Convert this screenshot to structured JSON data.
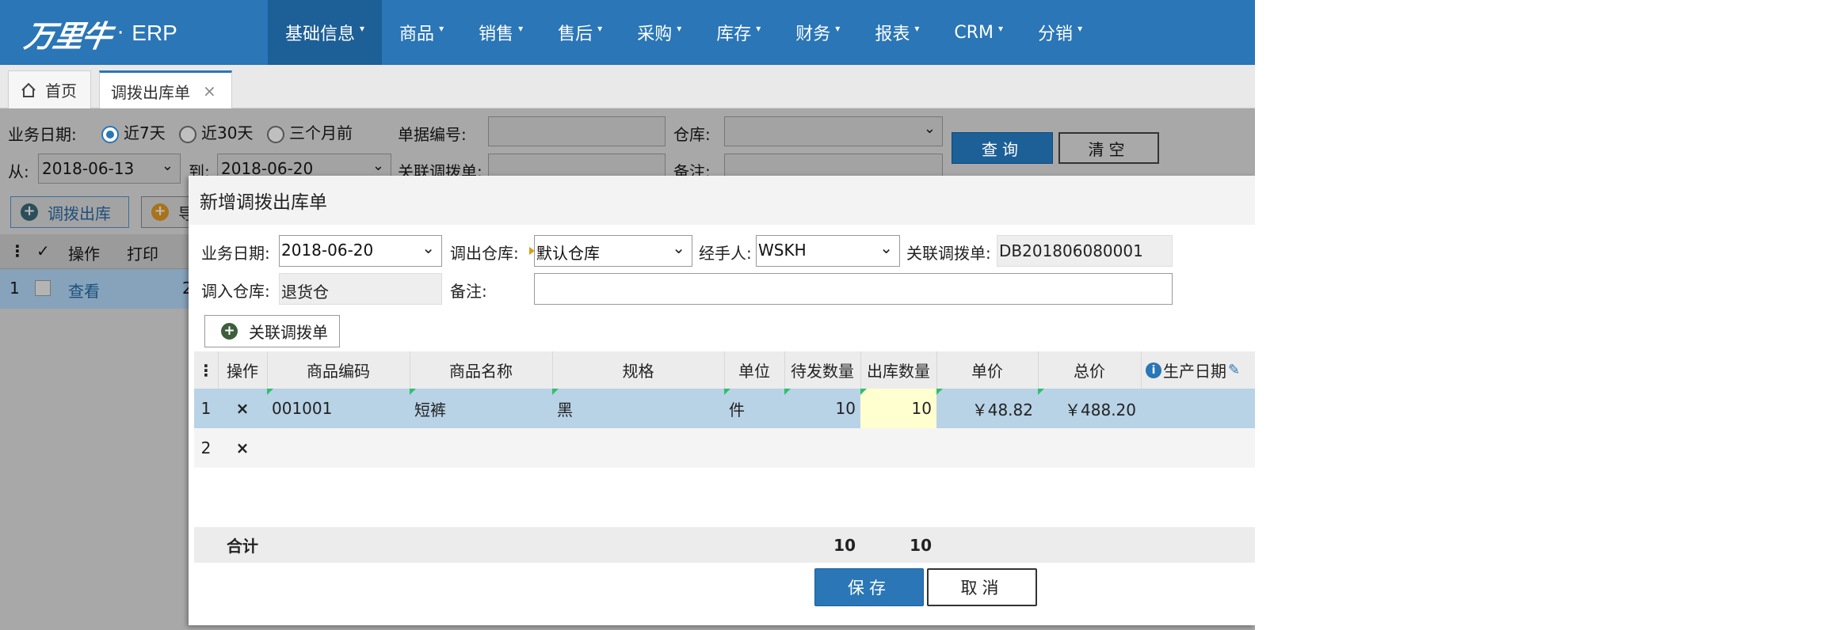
{
  "brand": {
    "logo_text": "万里牛",
    "dot": "·",
    "erp": "ERP"
  },
  "nav": [
    {
      "label": "基础信息",
      "active": true
    },
    {
      "label": "商品"
    },
    {
      "label": "销售"
    },
    {
      "label": "售后"
    },
    {
      "label": "采购"
    },
    {
      "label": "库存"
    },
    {
      "label": "财务"
    },
    {
      "label": "报表"
    },
    {
      "label": "CRM"
    },
    {
      "label": "分销"
    }
  ],
  "tabs": {
    "home": "首页",
    "active": "调拨出库单",
    "close": "×"
  },
  "filters": {
    "date_label": "业务日期:",
    "radio_7": "近7天",
    "radio_30": "近30天",
    "radio_3m": "三个月前",
    "bill_no_label": "单据编号:",
    "warehouse_label": "仓库:",
    "from_label": "从:",
    "from_value": "2018-06-13",
    "to_label": "到:",
    "to_value": "2018-06-20",
    "related_label": "关联调拨单:",
    "remark_label": "备注:",
    "query": "查询",
    "clear": "清空"
  },
  "actions": {
    "transfer_out": "调拨出库",
    "second": "导"
  },
  "bg_table": {
    "head": {
      "menu": "⋮",
      "check": "✓",
      "op": "操作",
      "print": "打印"
    },
    "row": {
      "no": "1",
      "view": "查看",
      "extra": "2"
    }
  },
  "modal": {
    "title": "新增调拨出库单",
    "date_label": "业务日期:",
    "date_value": "2018-06-20",
    "out_wh_label": "调出仓库:",
    "out_wh_value": "默认仓库",
    "handler_label": "经手人:",
    "handler_value": "WSKH",
    "related_label": "关联调拨单:",
    "related_value": "DB201806080001",
    "in_wh_label": "调入仓库:",
    "in_wh_value": "退货仓",
    "remark_label": "备注:",
    "link_button": "关联调拨单"
  },
  "grid": {
    "headers": {
      "menu": "⋮",
      "op": "操作",
      "code": "商品编码",
      "name": "商品名称",
      "spec": "规格",
      "unit": "单位",
      "pending": "待发数量",
      "outqty": "出库数量",
      "price": "单价",
      "total": "总价",
      "prod_date": "生产日期"
    },
    "rows": [
      {
        "no": "1",
        "del": "×",
        "code": "001001",
        "name": "短裤",
        "spec": "黑",
        "unit": "件",
        "pending": "10",
        "outqty": "10",
        "price": "￥48.82",
        "total": "￥488.20"
      },
      {
        "no": "2",
        "del": "×"
      }
    ],
    "footer": {
      "label": "合计",
      "pending": "10",
      "outqty": "10"
    }
  },
  "buttons": {
    "save": "保存",
    "cancel": "取消"
  },
  "colors": {
    "nav": "#2a76b6",
    "nav_active": "#1d5f97",
    "row_selected": "#b8d2e6",
    "edit_cell": "#ffffd0"
  }
}
